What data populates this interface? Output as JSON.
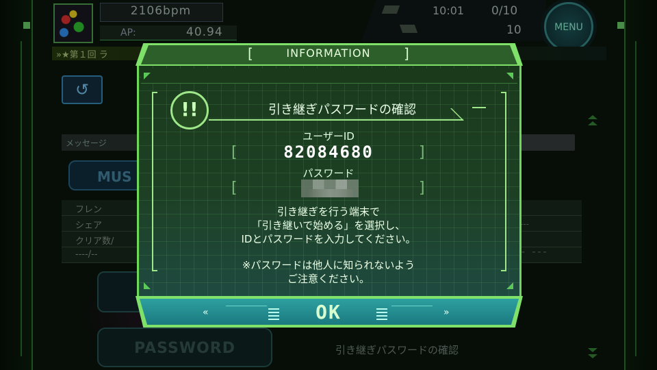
{
  "background": {
    "bpm": "2106bpm",
    "ap_label": "AP:",
    "ap_value": "40.94",
    "time": "10:01",
    "count": "0/10",
    "tickets": "10",
    "menu_label": "MENU",
    "banner_text": "»★第１回 ラ",
    "back_icon": "back-arrow-icon",
    "message_label": "メッセージ",
    "music_label": "MUS",
    "stats": [
      "フレン",
      "シェア",
      "クリア数/​",
      "----/--"
    ],
    "stat_right": "---",
    "stat_right2": "- ---",
    "password_button": "PASSWORD",
    "bottom_label": "引き継ぎパスワードの確認"
  },
  "dialog": {
    "title": "INFORMATION",
    "title_bracket_left": "[",
    "title_bracket_right": "]",
    "warn_symbol": "!!",
    "heading": "引き継ぎパスワードの確認",
    "user_id_label": "ユーザーID",
    "user_id_value": "82084680",
    "password_label": "パスワード",
    "bracket_left": "[",
    "bracket_right": "]",
    "message_lines": [
      "引き継ぎを行う端末で",
      "「引き継いで始める」を選択し、",
      "IDとパスワードを入力してください。",
      "※パスワードは他人に知られないよう",
      "ご注意ください。"
    ],
    "ok_label": "OK",
    "arrow_left": "«",
    "arrow_right": "»"
  },
  "colors": {
    "accent_green": "#7fe06a",
    "panel_dark": "#1d4024",
    "button_teal": "#1a7a80"
  }
}
